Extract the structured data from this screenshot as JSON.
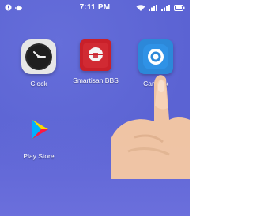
{
  "status_bar": {
    "time": "7:11 PM"
  },
  "home_screen": {
    "apps": [
      {
        "label": "Clock"
      },
      {
        "label": "Smartisan BBS"
      },
      {
        "label": "Camerix"
      },
      {
        "label": "Play Store"
      }
    ]
  },
  "colors": {
    "wallpaper": "#5b63d3",
    "bbs_red": "#c9202a",
    "camerix_blue": "#2c88d9"
  },
  "icons": {
    "left_status": [
      "notification-icon",
      "android-icon"
    ],
    "right_status": [
      "wifi-icon",
      "signal-icon",
      "signal-icon",
      "battery-icon"
    ]
  }
}
